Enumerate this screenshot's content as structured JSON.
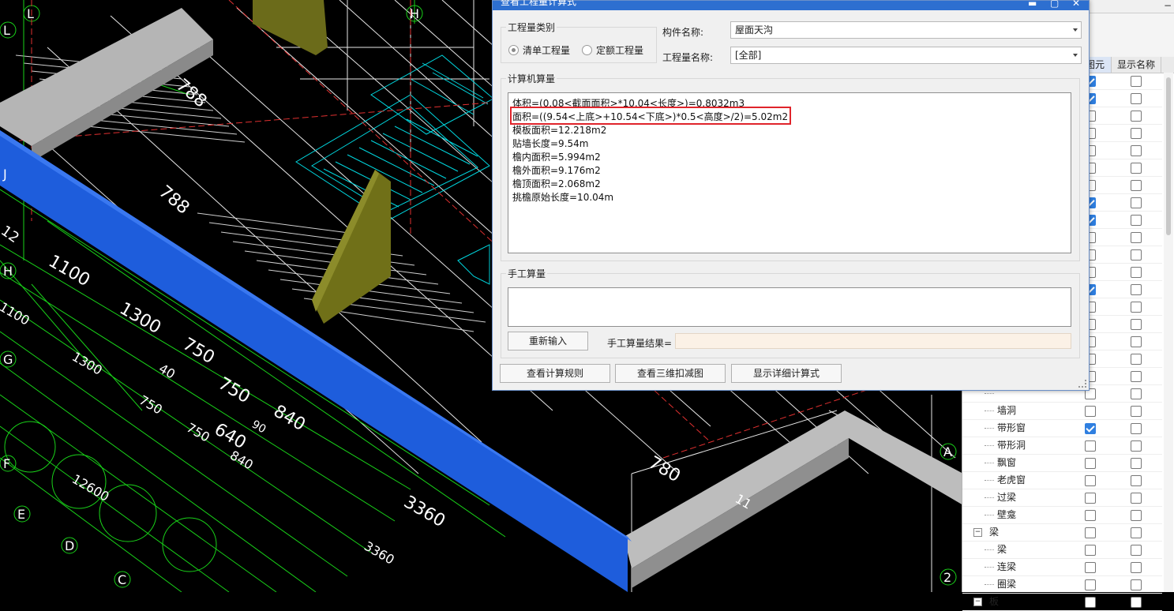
{
  "dialog": {
    "title": "查看工程量计算式",
    "controls": {
      "minimize": "▬",
      "maximize": "▢",
      "close": "✕"
    },
    "category": {
      "title": "工程量类别",
      "options": [
        {
          "label": "清单工程量",
          "selected": true
        },
        {
          "label": "定额工程量",
          "selected": false
        }
      ]
    },
    "component_name_label": "构件名称:",
    "component_name_value": "屋面天沟",
    "quantity_name_label": "工程量名称:",
    "quantity_name_value": "[全部]",
    "computer_section_title": "计算机算量",
    "calc_lines": [
      "体积=(0.08<截面面积>*10.04<长度>)=0.8032m3",
      "面积=((9.54<上底>+10.54<下底>)*0.5<高度>/2)=5.02m2",
      "模板面积=12.218m2",
      "贴墙长度=9.54m",
      "檐内面积=5.994m2",
      "檐外面积=9.176m2",
      "檐顶面积=2.068m2",
      "挑檐原始长度=10.04m"
    ],
    "manual_section_title": "手工算量",
    "reenter_button": "重新输入",
    "manual_result_label": "手工算量结果=",
    "buttons": [
      "查看计算规则",
      "查看三维扣减图",
      "显示详细计算式"
    ]
  },
  "right_panel": {
    "collapse_symbol": "−",
    "col_headers": [
      "图元",
      "显示名称"
    ],
    "rows": [
      {
        "label": "",
        "type": "leaf",
        "c1": true,
        "c2": false
      },
      {
        "label": "",
        "type": "leaf",
        "c1": true,
        "c2": false
      },
      {
        "label": "",
        "type": "leaf",
        "c1": false,
        "c2": false
      },
      {
        "label": "",
        "type": "leaf",
        "c1": false,
        "c2": false
      },
      {
        "label": "",
        "type": "leaf",
        "c1": false,
        "c2": false
      },
      {
        "label": "",
        "type": "leaf",
        "c1": false,
        "c2": false
      },
      {
        "label": "",
        "type": "leaf",
        "c1": false,
        "c2": false
      },
      {
        "label": "",
        "type": "leaf",
        "c1": true,
        "c2": false
      },
      {
        "label": "",
        "type": "leaf",
        "c1": true,
        "c2": false
      },
      {
        "label": "",
        "type": "leaf",
        "c1": false,
        "c2": false
      },
      {
        "label": "",
        "type": "leaf",
        "c1": false,
        "c2": false
      },
      {
        "label": "",
        "type": "leaf",
        "c1": false,
        "c2": false
      },
      {
        "label": "",
        "type": "leaf",
        "c1": true,
        "c2": false
      },
      {
        "label": "",
        "type": "leaf",
        "c1": false,
        "c2": false
      },
      {
        "label": "",
        "type": "leaf",
        "c1": false,
        "c2": false
      },
      {
        "label": "",
        "type": "leaf",
        "c1": false,
        "c2": false
      },
      {
        "label": "",
        "type": "leaf",
        "c1": false,
        "c2": false
      },
      {
        "label": "",
        "type": "leaf",
        "c1": false,
        "c2": false
      },
      {
        "label": "",
        "type": "leaf",
        "c1": false,
        "c2": false
      },
      {
        "label": "墙洞",
        "type": "leaf",
        "c1": false,
        "c2": false
      },
      {
        "label": "带形窗",
        "type": "leaf",
        "c1": true,
        "c2": false
      },
      {
        "label": "带形洞",
        "type": "leaf",
        "c1": false,
        "c2": false
      },
      {
        "label": "飘窗",
        "type": "leaf",
        "c1": false,
        "c2": false
      },
      {
        "label": "老虎窗",
        "type": "leaf",
        "c1": false,
        "c2": false
      },
      {
        "label": "过梁",
        "type": "leaf",
        "c1": false,
        "c2": false
      },
      {
        "label": "壁龛",
        "type": "leaf",
        "c1": false,
        "c2": false
      },
      {
        "label": "梁",
        "type": "group",
        "c1": false,
        "c2": false
      },
      {
        "label": "梁",
        "type": "leaf",
        "c1": false,
        "c2": false
      },
      {
        "label": "连梁",
        "type": "leaf",
        "c1": false,
        "c2": false
      },
      {
        "label": "圈梁",
        "type": "leaf",
        "c1": false,
        "c2": false
      },
      {
        "label": "板",
        "type": "group",
        "c1": false,
        "c2": false
      }
    ]
  },
  "cad": {
    "axis_labels": [
      "L",
      "L",
      "H",
      "J",
      "H",
      "G",
      "F",
      "E",
      "D",
      "C",
      "A",
      "2"
    ],
    "dimensions": [
      "788",
      "788",
      "1100",
      "1100",
      "1300",
      "1300",
      "12",
      "40",
      "750",
      "750",
      "750",
      "750",
      "840",
      "840",
      "90",
      "640",
      "12600",
      "3360",
      "3360",
      "780",
      "11"
    ]
  }
}
